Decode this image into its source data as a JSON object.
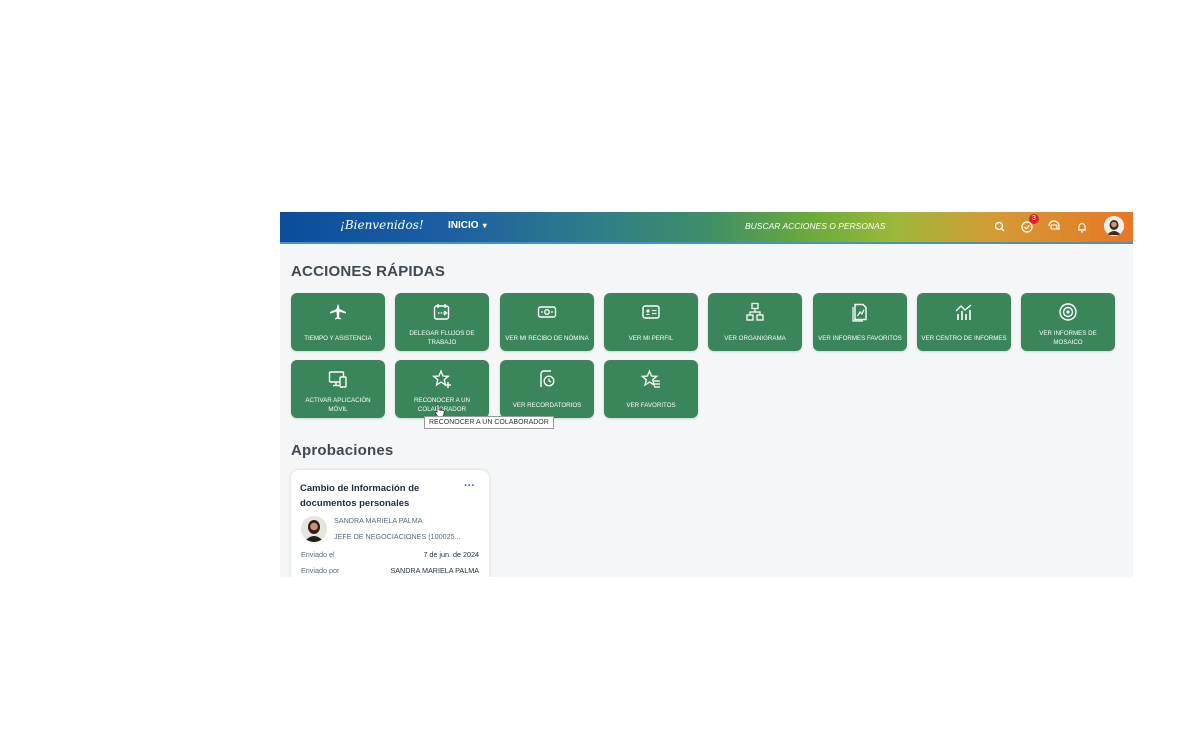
{
  "header": {
    "brand": "¡Bienvenidos!",
    "home_label": "INICIO",
    "search_placeholder": "BUSCAR ACCIONES O PERSONAS",
    "notification_count": "3"
  },
  "quick_actions": {
    "title": "ACCIONES RÁPIDAS",
    "tiles": [
      {
        "label": "TIEMPO Y ASISTENCIA",
        "icon": "airplane-icon"
      },
      {
        "label": "DELEGAR FLUJOS DE TRABAJO",
        "icon": "delegate-calendar-icon"
      },
      {
        "label": "VER MI RECIBO DE NÓMINA",
        "icon": "money-bill-icon"
      },
      {
        "label": "VER MI PERFIL",
        "icon": "id-card-icon"
      },
      {
        "label": "VER ORGANIGRAMA",
        "icon": "org-chart-icon"
      },
      {
        "label": "VER INFORMES FAVORITOS",
        "icon": "reports-icon"
      },
      {
        "label": "VER CENTRO DE INFORMES",
        "icon": "chart-icon"
      },
      {
        "label": "VER INFORMES DE MOSAICO",
        "icon": "target-icon"
      },
      {
        "label": "ACTIVAR APLICACIÓN MÓVIL",
        "icon": "device-icon"
      },
      {
        "label": "RECONOCER A UN COLABORADOR",
        "icon": "star-plus-icon"
      },
      {
        "label": "VER RECORDATORIOS",
        "icon": "reminder-icon"
      },
      {
        "label": "VER FAVORITOS",
        "icon": "star-list-icon"
      }
    ],
    "tooltip": "RECONOCER A UN COLABORADOR"
  },
  "approvals": {
    "title": "Aprobaciones",
    "card": {
      "title": "Cambio de Información de documentos personales",
      "more": "···",
      "person_name": "SANDRA MARIELA PALMA",
      "person_role": "JEFE DE NEGOCIACIONES (100025...",
      "sent_on_label": "Enviado el",
      "sent_on_value": "7 de jun. de 2024",
      "sent_by_label": "Enviado por",
      "sent_by_value": "SANDRA MARIELA PALMA"
    }
  },
  "colors": {
    "tile_green": "#3a8559",
    "badge_red": "#d6262b"
  }
}
